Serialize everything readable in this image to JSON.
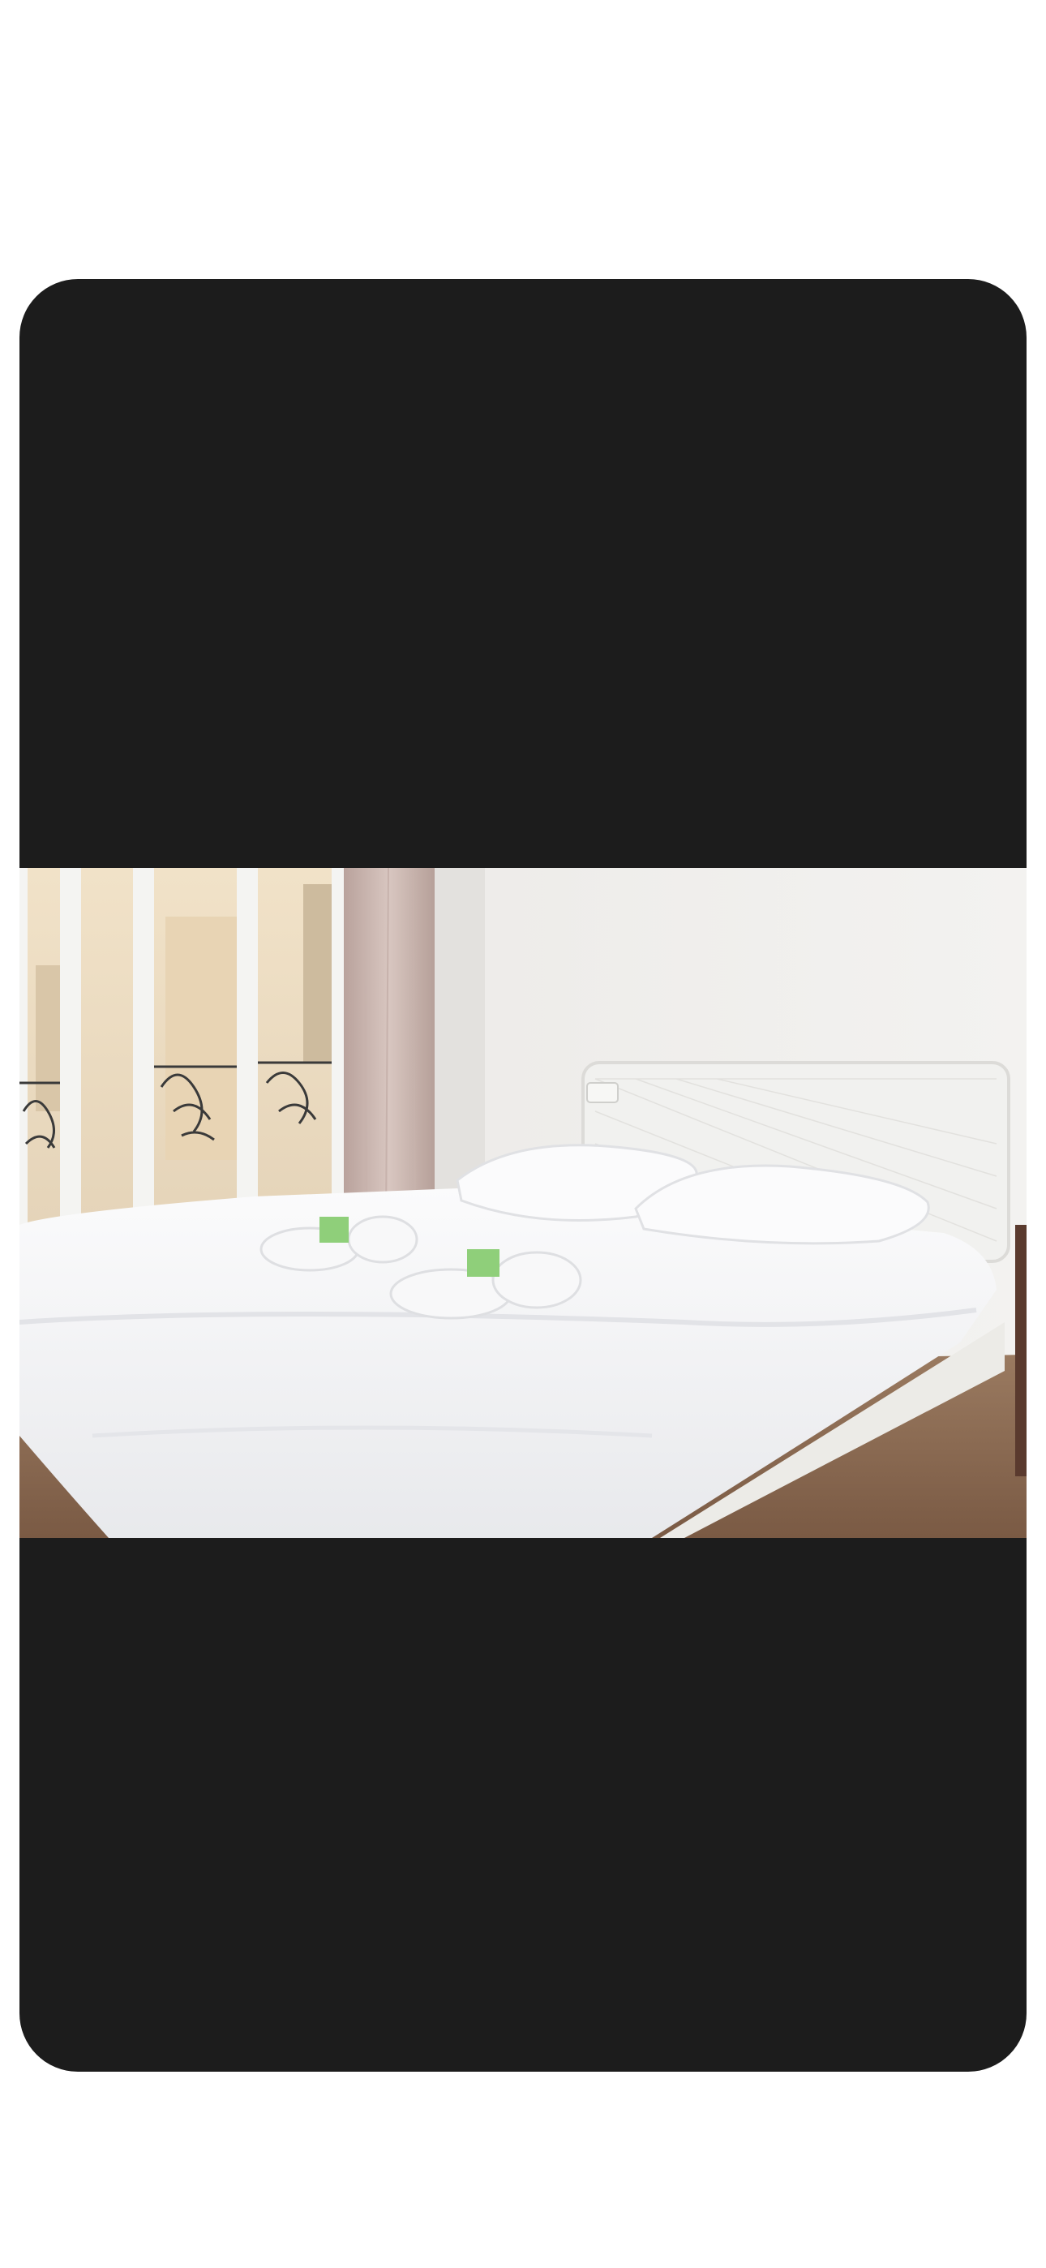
{
  "viewer": {
    "background_color": "#1c1c1c",
    "page_background_color": "#ffffff"
  },
  "photo": {
    "subject": "bedroom-bed-photo",
    "colors": {
      "wall": "#efeeec",
      "sheets": "#f7f7f8",
      "floor": "#8b6a52",
      "curtain": "#cdb8b2",
      "window_frame": "#f4f4f2",
      "ribbon": "#8fcf7a"
    }
  }
}
